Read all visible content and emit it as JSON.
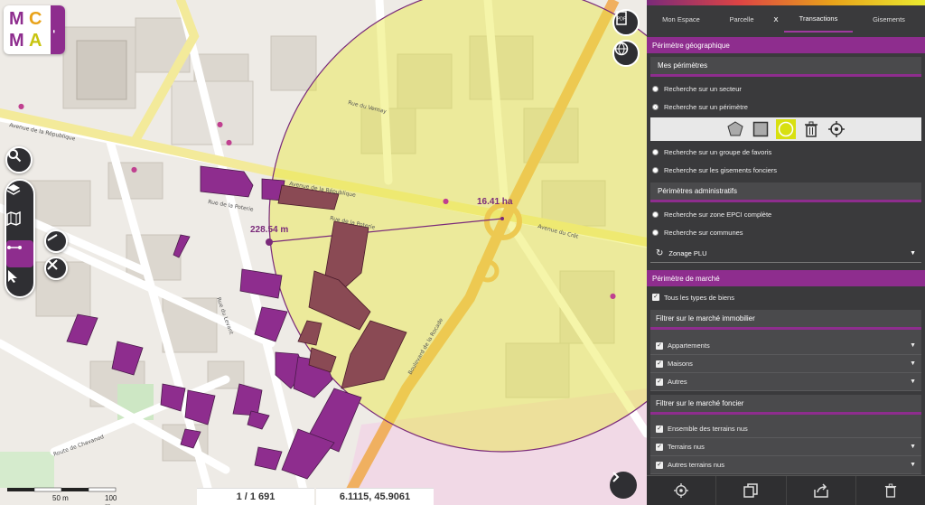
{
  "app": {
    "logo_letters": [
      "M",
      "C",
      "M",
      "A"
    ],
    "logo_more": "..."
  },
  "map": {
    "radius_label": "228.54 m",
    "area_label": "16.41 ha",
    "feature_count": "1 / 1 691",
    "coordinates": "6.1115, 45.9061",
    "scale_50": "50 m",
    "scale_100": "100 m",
    "street_labels": [
      "Avenue de la République",
      "Rue de la Poterie",
      "Avenue du Crêt",
      "Rue du Vernay",
      "Boulevard de la Rocade",
      "Route de Chavanod",
      "Rue du Levant"
    ],
    "circle_color": "#e8e840",
    "parcel_color": "#8e2d8e"
  },
  "panel": {
    "tabs": [
      {
        "label": "Mon Espace"
      },
      {
        "label": "Parcelle"
      },
      {
        "label": "X"
      },
      {
        "label": "Transactions"
      },
      {
        "label": "Gisements"
      }
    ],
    "geo_header": "Périmètre géographique",
    "mes_perimetres": "Mes périmètres",
    "radio_secteur": "Recherche sur un secteur",
    "radio_perimetre": "Recherche sur un périmètre",
    "radio_favoris": "Recherche sur un groupe de favoris",
    "radio_gisements": "Recherche sur les gisements fonciers",
    "admin_header": "Périmètres administratifs",
    "radio_epci": "Recherche sur zone EPCI complète",
    "radio_communes": "Recherche sur communes",
    "zonage": "Zonage PLU",
    "marche_header": "Périmètre de marché",
    "tous_types": "Tous les types de biens",
    "immobilier_header": "Filtrer sur le marché immobilier",
    "immobilier_items": [
      "Appartements",
      "Maisons",
      "Autres"
    ],
    "foncier_header": "Filtrer sur le marché foncier",
    "foncier_items": [
      "Ensemble des terrains nus",
      "Terrains nus",
      "Autres terrains nus"
    ],
    "accent": "#8e2d8e"
  }
}
